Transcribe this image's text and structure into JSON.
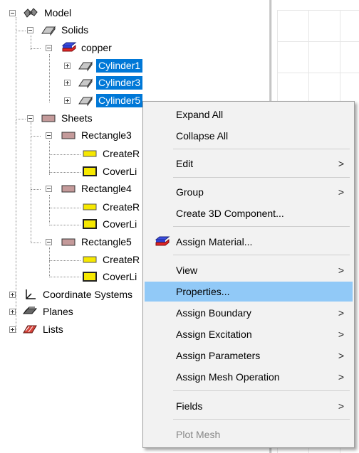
{
  "tree": {
    "model": "Model",
    "solids": "Solids",
    "copper": "copper",
    "cylinder1": "Cylinder1",
    "cylinder3": "Cylinder3",
    "cylinder5": "Cylinder5",
    "sheets": "Sheets",
    "rectangles": [
      {
        "label": "Rectangle3",
        "create": "CreateR",
        "cover": "CoverLi"
      },
      {
        "label": "Rectangle4",
        "create": "CreateR",
        "cover": "CoverLi"
      },
      {
        "label": "Rectangle5",
        "create": "CreateR",
        "cover": "CoverLi"
      }
    ],
    "coordinate_systems": "Coordinate Systems",
    "planes": "Planes",
    "lists": "Lists"
  },
  "context_menu": {
    "items": [
      {
        "label": "Expand All",
        "submenu": false
      },
      {
        "label": "Collapse All",
        "submenu": false
      },
      {
        "label": "Edit",
        "submenu": true
      },
      {
        "label": "Group",
        "submenu": true
      },
      {
        "label": "Create 3D Component...",
        "submenu": false
      },
      {
        "label": "Assign Material...",
        "submenu": false,
        "icon": "material-icon"
      },
      {
        "label": "View",
        "submenu": true
      },
      {
        "label": "Properties...",
        "submenu": false,
        "highlighted": true
      },
      {
        "label": "Assign Boundary",
        "submenu": true
      },
      {
        "label": "Assign Excitation",
        "submenu": true
      },
      {
        "label": "Assign Parameters",
        "submenu": true
      },
      {
        "label": "Assign Mesh Operation",
        "submenu": true
      },
      {
        "label": "Fields",
        "submenu": true
      },
      {
        "label": "Plot Mesh",
        "submenu": false,
        "disabled": true
      }
    ],
    "submenu_arrow": ">"
  },
  "colors": {
    "selection": "#0078d7",
    "menu_highlight": "#91c9f7",
    "menu_background": "#f2f2f2"
  }
}
